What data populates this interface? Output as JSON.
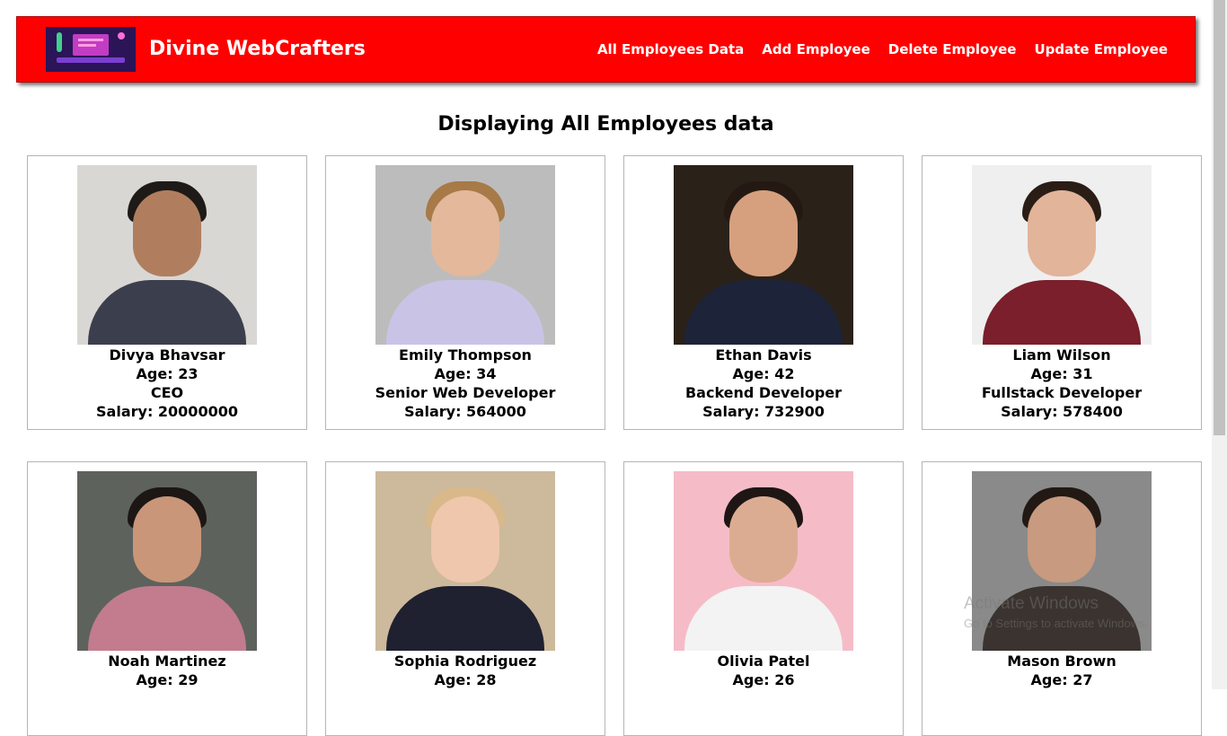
{
  "header": {
    "brand": "Divine WebCrafters",
    "nav": [
      "All Employees Data",
      "Add Employee",
      "Delete Employee",
      "Update Employee"
    ],
    "colors": {
      "navbar": "#ff0000",
      "text": "#ffffff"
    }
  },
  "page": {
    "title": "Displaying All Employees data"
  },
  "employees": [
    {
      "name": "Divya Bhavsar",
      "age": "Age: 23",
      "role": "CEO",
      "salary": "Salary: 20000000"
    },
    {
      "name": "Emily Thompson",
      "age": "Age: 34",
      "role": "Senior Web Developer",
      "salary": "Salary: 564000"
    },
    {
      "name": "Ethan Davis",
      "age": "Age: 42",
      "role": "Backend Developer",
      "salary": "Salary: 732900"
    },
    {
      "name": "Liam Wilson",
      "age": "Age: 31",
      "role": "Fullstack Developer",
      "salary": "Salary: 578400"
    },
    {
      "name": "Noah Martinez",
      "age": "Age: 29"
    },
    {
      "name": "Sophia Rodriguez",
      "age": "Age: 28"
    },
    {
      "name": "Olivia Patel",
      "age": "Age: 26"
    },
    {
      "name": "Mason Brown",
      "age": "Age: 27"
    }
  ],
  "watermark": {
    "line1": "Activate Windows",
    "line2": "Go to Settings to activate Windows."
  }
}
